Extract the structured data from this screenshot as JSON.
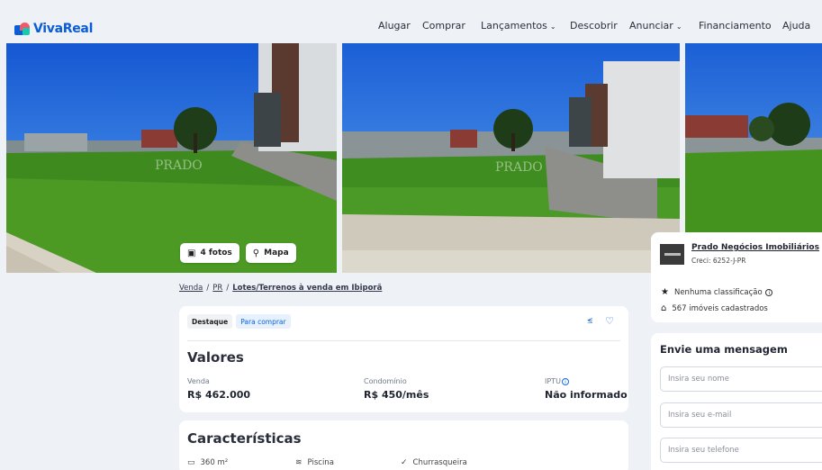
{
  "header": {
    "logo_text": "VivaReal",
    "nav": {
      "alugar": "Alugar",
      "comprar": "Comprar",
      "lancamentos": "Lançamentos",
      "descobrir": "Descobrir",
      "anunciar": "Anunciar",
      "financiamento": "Financiamento",
      "ajuda": "Ajuda"
    }
  },
  "gallery": {
    "watermark": "PRADO",
    "photos_button": "4 fotos",
    "map_button": "Mapa"
  },
  "breadcrumb": {
    "level1": "Venda",
    "level2": "PR",
    "current": "Lotes/Terrenos à venda em Ibiporã"
  },
  "listing": {
    "tag_featured": "Destaque",
    "tag_type": "Para comprar",
    "values_title": "Valores",
    "venda_label": "Venda",
    "venda_value": "R$ 462.000",
    "condominio_label": "Condomínio",
    "condominio_value": "R$ 450/mês",
    "iptu_label": "IPTU",
    "iptu_value": "Não informado"
  },
  "features": {
    "title": "Características",
    "area": "360 m²",
    "pool": "Piscina",
    "bbq": "Churrasqueira"
  },
  "agent": {
    "name": "Prado Negócios Imobiliários",
    "creci": "Creci: 6252-J-PR",
    "rating": "Nenhuma classificação",
    "properties": "567 imóveis cadastrados"
  },
  "contact_form": {
    "title": "Envie uma mensagem",
    "name_placeholder": "Insira seu nome",
    "email_placeholder": "Insira seu e-mail",
    "phone_placeholder": "Insira seu telefone"
  },
  "colors": {
    "brand": "#0a5cd7",
    "accent": "#1a6ad8",
    "background": "#eef1f6"
  }
}
